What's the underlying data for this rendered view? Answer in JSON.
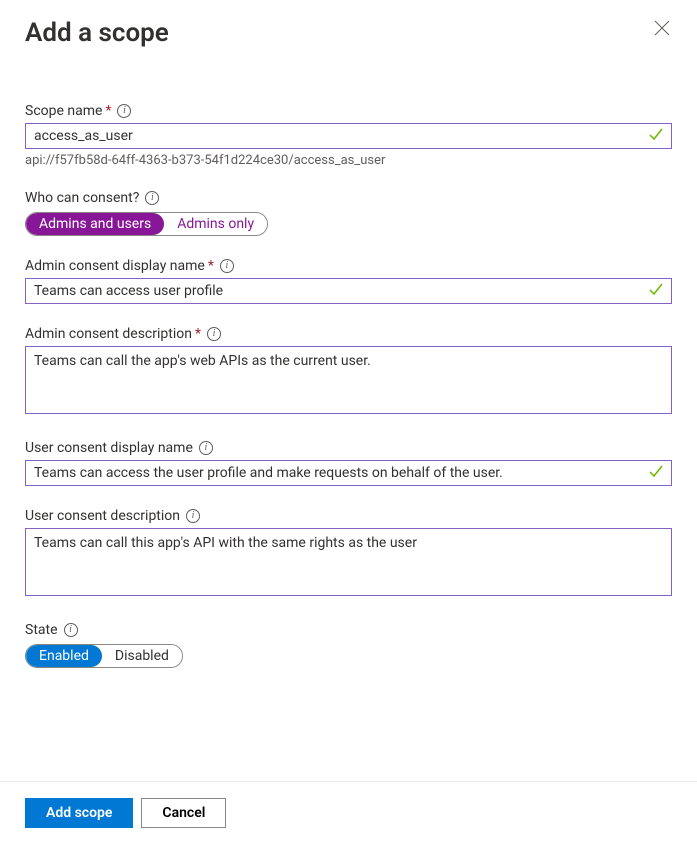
{
  "title": "Add a scope",
  "fields": {
    "scope_name": {
      "label": "Scope name",
      "value": "access_as_user",
      "hint": "api://f57fb58d-64ff-4363-b373-54f1d224ce30/access_as_user"
    },
    "who_can_consent": {
      "label": "Who can consent?",
      "option1": "Admins and users",
      "option2": "Admins only"
    },
    "admin_display_name": {
      "label": "Admin consent display name",
      "value": "Teams can access user profile"
    },
    "admin_description": {
      "label": "Admin consent description",
      "value": "Teams can call the app's web APIs as the current user."
    },
    "user_display_name": {
      "label": "User consent display name",
      "value": "Teams can access the user profile and make requests on behalf of the user."
    },
    "user_description": {
      "label": "User consent description",
      "value": "Teams can call this app's API with the same rights as the user"
    },
    "state": {
      "label": "State",
      "option1": "Enabled",
      "option2": "Disabled"
    }
  },
  "footer": {
    "primary": "Add scope",
    "secondary": "Cancel"
  }
}
